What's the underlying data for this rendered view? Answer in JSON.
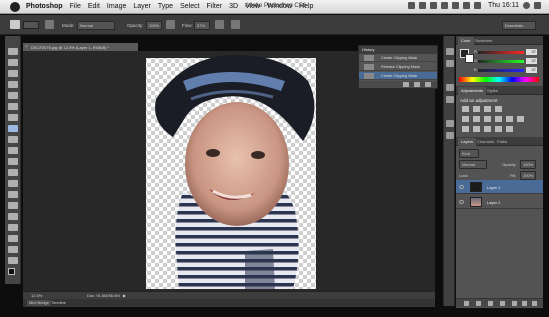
{
  "menubar": {
    "app_name": "Photoshop",
    "items": [
      "File",
      "Edit",
      "Image",
      "Layer",
      "Type",
      "Select",
      "Filter",
      "3D",
      "View",
      "Window",
      "Help"
    ],
    "window_title": "Adobe Photoshop CS6",
    "clock": "Thu 16:11"
  },
  "options_bar": {
    "mode_label": "Mode:",
    "mode_value": "Normal",
    "opacity_label": "Opacity:",
    "opacity_value": "100%",
    "flow_label": "Flow:",
    "flow_value": "57%",
    "workspace": "Essentials"
  },
  "document": {
    "tab_title": "DSCF2076.jpg @ 12.5% (Layer 1, RGB/8) *",
    "zoom": "12.5%",
    "doc_size": "Doc: 91.6M/56.9M"
  },
  "bottom_tabs": [
    "Mini Bridge",
    "Timeline"
  ],
  "history": {
    "title": "History",
    "entries": [
      "Create Clipping Mask",
      "Release Clipping Mask",
      "Create Clipping Mask"
    ]
  },
  "color_panel": {
    "tabs": [
      "Color",
      "Swatches"
    ],
    "channels": [
      {
        "label": "R",
        "value": "37",
        "color": "#e34040"
      },
      {
        "label": "G",
        "value": "37",
        "color": "#3fbf3f"
      },
      {
        "label": "B",
        "value": "37",
        "color": "#4060e0"
      }
    ]
  },
  "adjustments_panel": {
    "tabs": [
      "Adjustments",
      "Styles"
    ],
    "heading": "Add an adjustment"
  },
  "layers_panel": {
    "tabs": [
      "Layers",
      "Channels",
      "Paths"
    ],
    "kind": "Kind",
    "blend_mode": "Normal",
    "opacity_label": "Opacity:",
    "opacity_value": "100%",
    "lock_label": "Lock:",
    "fill_label": "Fill:",
    "fill_value": "100%",
    "layers": [
      {
        "name": "Layer 1",
        "selected": true
      },
      {
        "name": "Layer 2",
        "selected": false
      }
    ]
  },
  "colors": {
    "ui_dark": "#3c3c3c",
    "panel": "#535353",
    "selection": "#4a6b96"
  }
}
